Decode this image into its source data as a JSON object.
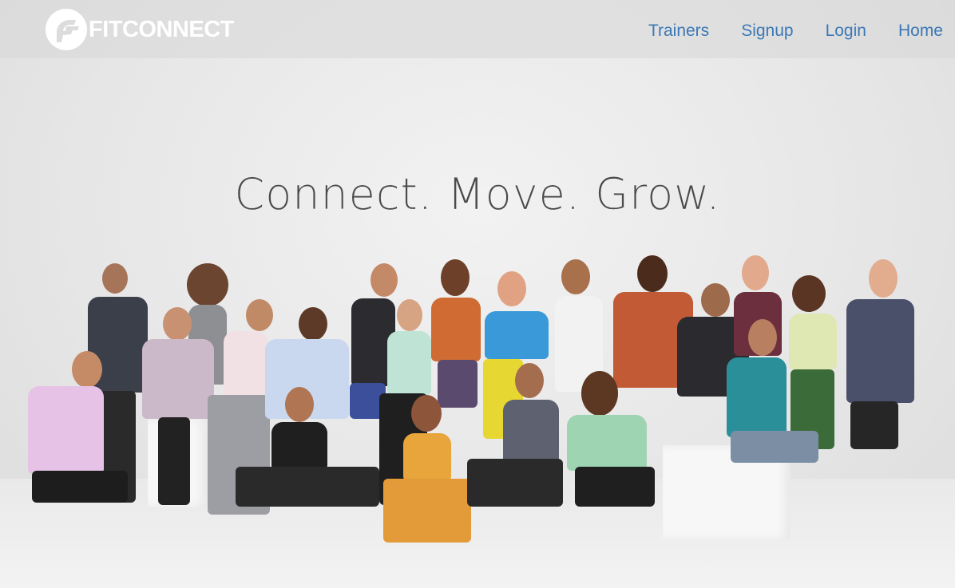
{
  "brand": {
    "name": "FITCONNECT",
    "logo_icon": "fitconnect-logo-icon"
  },
  "nav": {
    "items": [
      {
        "label": "Trainers"
      },
      {
        "label": "Signup"
      },
      {
        "label": "Login"
      },
      {
        "label": "Home"
      }
    ]
  },
  "hero": {
    "headline": "Connect. Move. Grow.",
    "image": "group-of-fitness-trainers-photo"
  },
  "colors": {
    "nav_link": "#3b78b5",
    "logo": "#ffffff",
    "background": "#e6e6e6"
  }
}
